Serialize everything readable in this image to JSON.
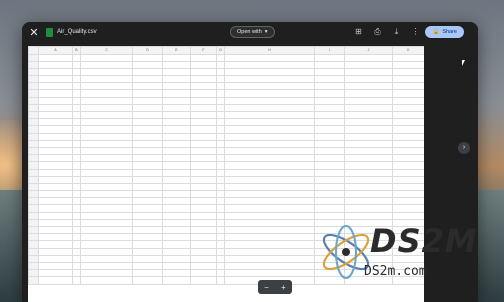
{
  "window": {
    "file_name": "Air_Quality.csv",
    "open_with_label": "Open with",
    "share_label": "Share"
  },
  "sheet": {
    "col_headers": [
      "",
      "A",
      "B",
      "C",
      "D",
      "E",
      "F",
      "G",
      "H",
      "I",
      "J",
      "K"
    ],
    "rows": [
      [
        "",
        "",
        "",
        "",
        "",
        "",
        "",
        "",
        "",
        "",
        "",
        ""
      ],
      [
        "",
        "",
        "",
        "",
        "",
        "",
        "",
        "",
        "",
        "",
        "",
        ""
      ],
      [
        "",
        "",
        "",
        "",
        "",
        "",
        "",
        "",
        "",
        "",
        "",
        ""
      ]
    ],
    "zoom_minus": "−",
    "zoom_plus": "+"
  },
  "watermark": {
    "brand": "DS2M",
    "domain": "DS2m.com"
  }
}
